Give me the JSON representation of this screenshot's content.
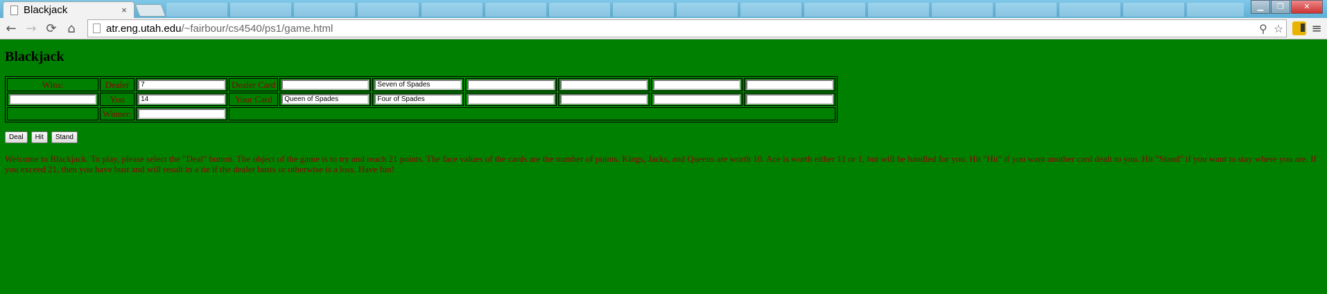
{
  "browser": {
    "tab_title": "Blackjack",
    "tab_close": "×",
    "url_host": "atr.eng.utah.edu",
    "url_path": "/~fairbour/cs4540/ps1/game.html",
    "win_minimize": "▁",
    "win_restore": "❐",
    "win_close": "✕",
    "back": "←",
    "forward": "→",
    "reload": "⟳",
    "home": "⌂",
    "search_glyph": "⚲",
    "star_glyph": "☆",
    "menu_glyph": "≡"
  },
  "page": {
    "title": "Blackjack",
    "table": {
      "wins_label": "Wins:",
      "wins_value": "",
      "dealer_label": "Dealer",
      "dealer_score": "7",
      "you_label": "You",
      "you_score": "14",
      "winner_label": "Winner:",
      "winner_value": "",
      "dealer_card_label": "Dealer Card",
      "your_card_label": "Your Card",
      "dealer_cards": [
        "",
        "Seven of Spades",
        "",
        "",
        "",
        ""
      ],
      "your_cards": [
        "Queen of Spades",
        "Four of Spades",
        "",
        "",
        "",
        ""
      ]
    },
    "buttons": {
      "deal": "Deal",
      "hit": "Hit",
      "stand": "Stand"
    },
    "instructions": "Welcome to Blackjack. To play, please select the \"Deal\" button. The object of the game is to try and reach 21 points. The face values of the cards are the number of points. Kings, Jacks, and Queens are worth 10. Ace is worth either 11 or 1, but will be handled for you. Hit \"Hit\" if you want another card dealt to you. Hit \"Stand\" if you want to stay where you are. If you exceed 21, then you have bust and will result in a tie if the dealer busts or otherwise is a loss. Have fun!"
  },
  "colors": {
    "page_background": "#008000",
    "text": "#8b0000"
  }
}
